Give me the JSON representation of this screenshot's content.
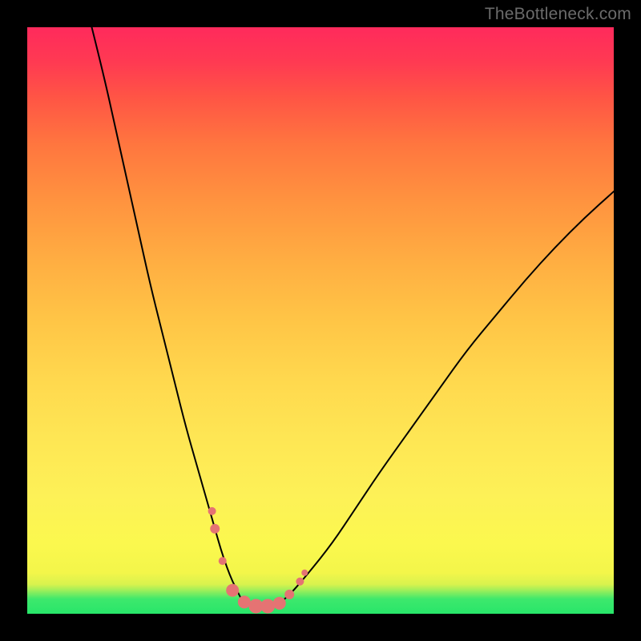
{
  "watermark": {
    "text": "TheBottleneck.com"
  },
  "colors": {
    "frame": "#000000",
    "curve_stroke": "#000000",
    "marker_fill": "#e57373",
    "gradient_stops": [
      "#28e66a",
      "#fdf157",
      "#ffae42",
      "#ff2a5c"
    ]
  },
  "chart_data": {
    "type": "line",
    "title": "",
    "xlabel": "",
    "ylabel": "",
    "xlim": [
      0,
      100
    ],
    "ylim": [
      0,
      100
    ],
    "grid": false,
    "legend": false,
    "note": "values are read off pixel positions (no axis ticks present); higher y = higher on image",
    "series": [
      {
        "name": "left-branch",
        "x": [
          11,
          13,
          15,
          17,
          19,
          21,
          23,
          25,
          27,
          29,
          31,
          32,
          33,
          34,
          35,
          36,
          36.5
        ],
        "y": [
          100,
          92,
          83,
          74,
          65,
          56,
          48,
          40,
          32,
          25,
          18,
          14.5,
          11,
          8,
          5.5,
          3.5,
          2.5
        ]
      },
      {
        "name": "valley-floor",
        "x": [
          36.5,
          38,
          40,
          42,
          43.5
        ],
        "y": [
          2.5,
          1.5,
          1.3,
          1.5,
          2.2
        ]
      },
      {
        "name": "right-branch",
        "x": [
          43.5,
          45,
          48,
          52,
          56,
          60,
          65,
          70,
          75,
          80,
          85,
          90,
          95,
          100
        ],
        "y": [
          2.2,
          3.5,
          7,
          12,
          18,
          24,
          31,
          38,
          45,
          51,
          57,
          62.5,
          67.5,
          72
        ]
      }
    ],
    "markers": {
      "name": "highlighted-points",
      "note": "salmon/pink dots near valley; sizes approx in px-radius of rendered dot",
      "points": [
        {
          "x": 31.5,
          "y": 17.5,
          "r": 5
        },
        {
          "x": 32.0,
          "y": 14.5,
          "r": 6
        },
        {
          "x": 33.3,
          "y": 9.0,
          "r": 5
        },
        {
          "x": 35.0,
          "y": 4.0,
          "r": 8
        },
        {
          "x": 37.0,
          "y": 2.0,
          "r": 8
        },
        {
          "x": 39.0,
          "y": 1.3,
          "r": 9
        },
        {
          "x": 41.0,
          "y": 1.3,
          "r": 9
        },
        {
          "x": 43.0,
          "y": 1.8,
          "r": 8
        },
        {
          "x": 44.7,
          "y": 3.3,
          "r": 6
        },
        {
          "x": 46.5,
          "y": 5.5,
          "r": 5
        },
        {
          "x": 47.3,
          "y": 7.0,
          "r": 4
        }
      ]
    }
  }
}
